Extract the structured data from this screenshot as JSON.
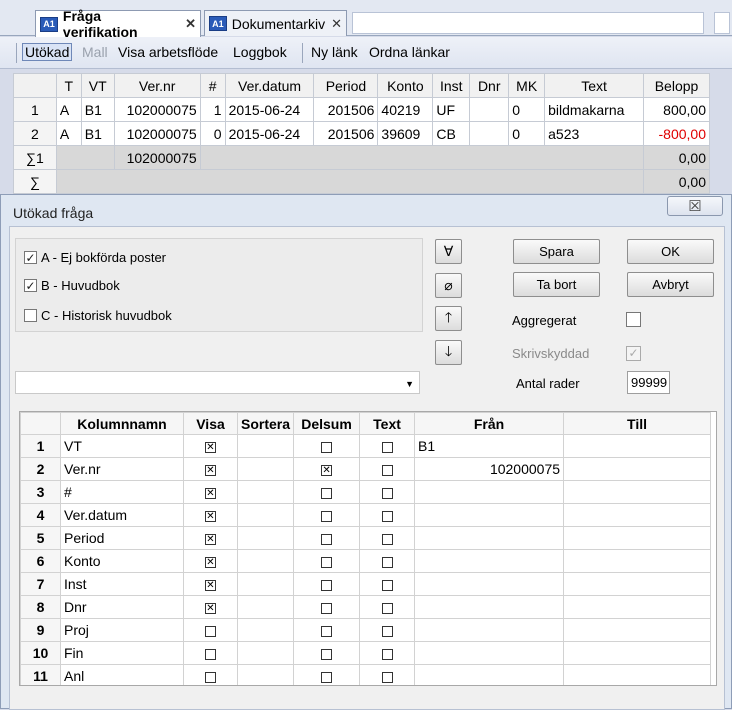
{
  "tabs": [
    {
      "icon": "A1",
      "label": "Fråga verifikation",
      "close": "✕"
    },
    {
      "icon": "A1",
      "label": "Dokumentarkiv",
      "close": "✕"
    }
  ],
  "toolbar": {
    "utokad": "Utökad",
    "mall": "Mall",
    "visa_arbetsflode": "Visa arbetsflöde",
    "loggbok": "Loggbok",
    "ny_lank": "Ny länk",
    "ordna_lankar": "Ordna länkar"
  },
  "main_grid": {
    "headers": [
      "",
      "T",
      "VT",
      "Ver.nr",
      "#",
      "Ver.datum",
      "Period",
      "Konto",
      "Inst",
      "Dnr",
      "MK",
      "Text",
      "Belopp"
    ],
    "rows": [
      [
        "1",
        "A",
        "B1",
        "102000075",
        "1",
        "2015-06-24",
        "201506",
        "40219",
        "UF",
        "",
        "0",
        "bildmakarna",
        "800,00"
      ],
      [
        "2",
        "A",
        "B1",
        "102000075",
        "0",
        "2015-06-24",
        "201506",
        "39609",
        "CB",
        "",
        "0",
        "a523",
        "-800,00"
      ]
    ],
    "sum1": {
      "label": "∑1",
      "vernr": "102000075",
      "belopp": "0,00"
    },
    "sum": {
      "label": "∑",
      "belopp": "0,00"
    }
  },
  "dialog": {
    "title": "Utökad fråga",
    "close": "☒",
    "sources": [
      {
        "label": "A - Ej bokförda poster",
        "checked": true
      },
      {
        "label": "B - Huvudbok",
        "checked": true
      },
      {
        "label": "C - Historisk huvudbok",
        "checked": false
      }
    ],
    "icons": {
      "all": "∀",
      "none": "⌀",
      "up": "🡑",
      "down": "🡓"
    },
    "buttons": {
      "spara": "Spara",
      "ta_bort": "Ta bort",
      "ok": "OK",
      "avbryt": "Avbryt"
    },
    "aggregerat": "Aggregerat",
    "skrivskyddad": "Skrivskyddad",
    "antal_rader_label": "Antal rader",
    "antal_rader_value": "99999",
    "combo_value": ""
  },
  "column_grid": {
    "headers": [
      "",
      "Kolumnnamn",
      "Visa",
      "Sortera",
      "Delsum",
      "Text",
      "Från",
      "Till"
    ],
    "rows": [
      {
        "n": "1",
        "name": "VT",
        "visa": true,
        "delsum": false,
        "text": false,
        "fran": "B1",
        "fran_align": "left",
        "till": ""
      },
      {
        "n": "2",
        "name": "Ver.nr",
        "visa": true,
        "delsum": true,
        "text": false,
        "fran": "102000075",
        "fran_align": "right",
        "till": ""
      },
      {
        "n": "3",
        "name": "#",
        "visa": true,
        "delsum": false,
        "text": false,
        "fran": "",
        "till": ""
      },
      {
        "n": "4",
        "name": "Ver.datum",
        "visa": true,
        "delsum": false,
        "text": false,
        "fran": "",
        "till": ""
      },
      {
        "n": "5",
        "name": "Period",
        "visa": true,
        "delsum": false,
        "text": false,
        "fran": "",
        "till": ""
      },
      {
        "n": "6",
        "name": "Konto",
        "visa": true,
        "delsum": false,
        "text": false,
        "fran": "",
        "till": ""
      },
      {
        "n": "7",
        "name": "Inst",
        "visa": true,
        "delsum": false,
        "text": false,
        "fran": "",
        "till": ""
      },
      {
        "n": "8",
        "name": "Dnr",
        "visa": true,
        "delsum": false,
        "text": false,
        "fran": "",
        "till": ""
      },
      {
        "n": "9",
        "name": "Proj",
        "visa": false,
        "delsum": false,
        "text": false,
        "fran": "",
        "till": ""
      },
      {
        "n": "10",
        "name": "Fin",
        "visa": false,
        "delsum": false,
        "text": false,
        "fran": "",
        "till": ""
      },
      {
        "n": "11",
        "name": "Anl",
        "visa": false,
        "delsum": false,
        "text": false,
        "fran": "",
        "till": ""
      }
    ]
  }
}
